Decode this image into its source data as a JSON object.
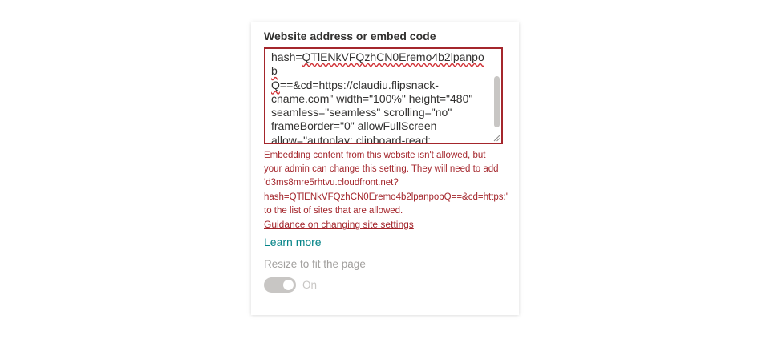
{
  "field": {
    "label": "Website address or embed code",
    "value_prefix": "hash=",
    "value_misspelled_1": "QTlENkVFQzhCN0Eremo4b2lpanpob",
    "value_misspelled_2": "Q",
    "value_rest": "==&cd=https://claudiu.flipsnack-\ncname.com\" width=\"100%\" height=\"480\"\nseamless=\"seamless\" scrolling=\"no\"\nframeBorder=\"0\" allowFullScreen\nallow=\"autoplay; clipboard-read;\nclipboard-write\"> </iframe>"
  },
  "error": {
    "message": "Embedding content from this website isn't allowed, but\nyour admin can change this setting. They will need to add\n'd3ms8mre5rhtvu.cloudfront.net?\nhash=QTlENkVFQzhCN0Eremo4b2lpanpobQ==&cd=https:'\nto the list of sites that are allowed."
  },
  "links": {
    "guidance": "Guidance on changing site settings",
    "learn_more": "Learn more"
  },
  "resize": {
    "label": "Resize to fit the page",
    "toggle_state": "On",
    "toggle_on": true,
    "disabled": true
  },
  "colors": {
    "error": "#a4262c",
    "link_teal": "#038387",
    "disabled_text": "#a19f9d",
    "toggle_disabled": "#c8c6c4"
  }
}
